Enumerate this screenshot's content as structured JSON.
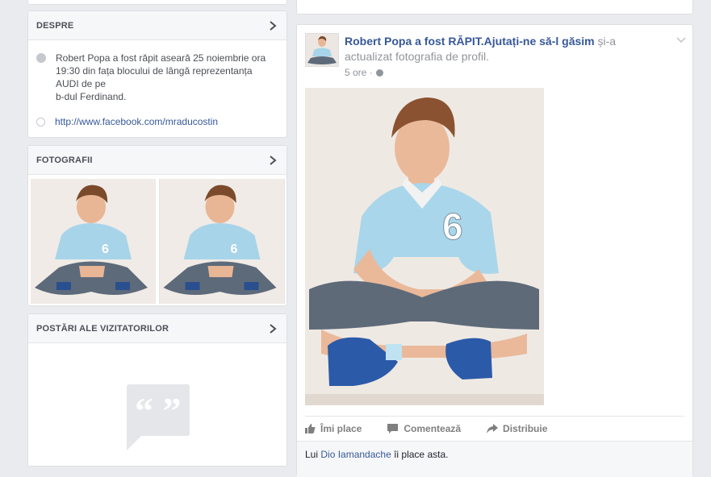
{
  "about": {
    "title": "DESPRE",
    "description": "Robert Popa a fost răpit aseară 25 noiembrie ora 19:30 din fața blocului de lângă reprezentanța AUDI de pe\nb-dul Ferdinand.",
    "link": "http://www.facebook.com/mraducostin"
  },
  "photos": {
    "title": "FOTOGRAFII"
  },
  "visitor_posts": {
    "title": "POSTĂRI ALE VIZITATORILOR"
  },
  "post": {
    "author": "Robert Popa a fost RĂPIT.Ajutați-ne să-l găsim",
    "action": " și-a actualizat fotografia de profil.",
    "time": "5 ore",
    "time_sep": " · ",
    "like_label": "Îmi place",
    "comment_label": "Comentează",
    "share_label": "Distribuie",
    "likes_prefix": "Lui ",
    "likes_name": "Dio Iamandache",
    "likes_suffix": " îi place asta."
  },
  "colors": {
    "link": "#365899",
    "background": "#e9ebee"
  }
}
